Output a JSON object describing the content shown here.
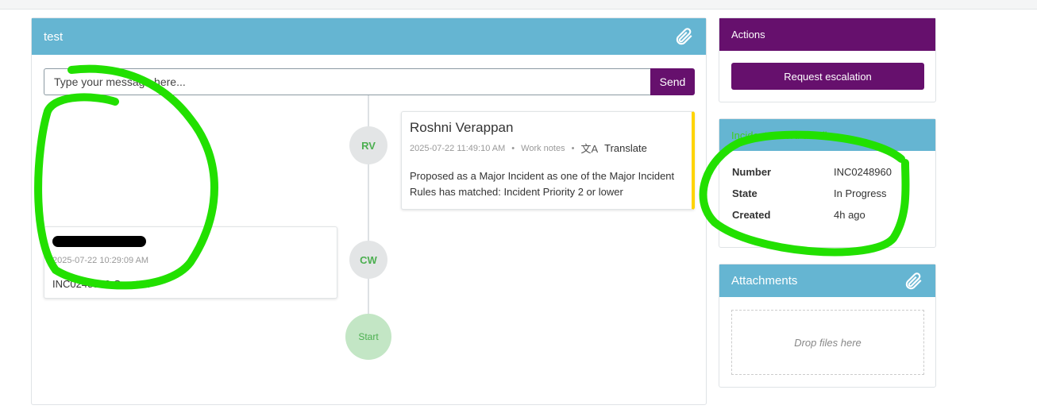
{
  "main": {
    "title": "test",
    "message_placeholder": "Type your message here...",
    "send_label": "Send",
    "entries": [
      {
        "initials": "RV",
        "author": "Roshni Verappan",
        "timestamp": "2025-07-22 11:49:10 AM",
        "type": "Work notes",
        "translate": "Translate",
        "text": "Proposed as a Major Incident as one of the Major Incident Rules has matched: Incident Priority 2 or lower"
      },
      {
        "initials": "CW",
        "timestamp": "2025-07-22 10:29:09 AM",
        "text": "INC0248960 Created"
      }
    ],
    "start_label": "Start"
  },
  "actions": {
    "title": "Actions",
    "escalation_label": "Request escalation"
  },
  "details": {
    "title": "Incident record details",
    "rows": [
      {
        "label": "Number",
        "value": "INC0248960"
      },
      {
        "label": "State",
        "value": "In Progress"
      },
      {
        "label": "Created",
        "value": "4h ago"
      }
    ]
  },
  "attachments": {
    "title": "Attachments",
    "drop_text": "Drop files here"
  },
  "colors": {
    "header": "#65b5d2",
    "accent": "#66106d",
    "annotation": "#22e000"
  }
}
